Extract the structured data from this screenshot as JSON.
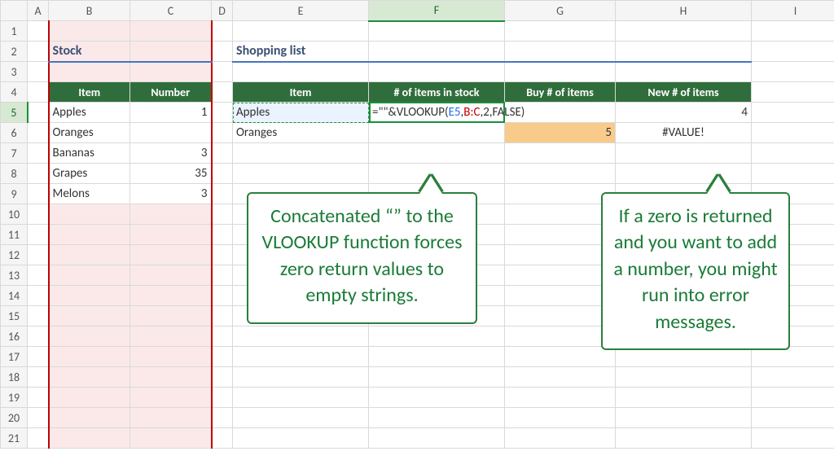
{
  "columns": [
    "A",
    "B",
    "C",
    "D",
    "E",
    "F",
    "G",
    "H",
    "I"
  ],
  "row_count": 21,
  "selected_col": "F",
  "selected_row": 5,
  "stock": {
    "title": "Stock",
    "headers": {
      "item": "Item",
      "number": "Number"
    },
    "rows": [
      {
        "item": "Apples",
        "number": "1"
      },
      {
        "item": "Oranges",
        "number": ""
      },
      {
        "item": "Bananas",
        "number": "3"
      },
      {
        "item": "Grapes",
        "number": "35"
      },
      {
        "item": "Melons",
        "number": "3"
      }
    ]
  },
  "shopping": {
    "title": "Shopping list",
    "headers": {
      "item": "Item",
      "in_stock": "# of items in stock",
      "buy": "Buy # of items",
      "new": "New # of items"
    },
    "rows": [
      {
        "item": "Apples",
        "in_stock": "",
        "buy": "",
        "new": "4"
      },
      {
        "item": "Oranges",
        "in_stock": "",
        "buy": "5",
        "new": "#VALUE!"
      }
    ]
  },
  "formula": {
    "prefix": "=\"\"&VLOOKUP(",
    "arg1": "E5",
    "sep1": ",",
    "arg2": "B:C",
    "rest": ",2,FALSE)"
  },
  "callouts": {
    "left": "Concatenated “” to the VLOOKUP function forces zero return values to empty strings.",
    "right": "If a zero is returned and you want to add a number, you might run into error messages."
  },
  "chart_data": {
    "type": "table",
    "tables": [
      {
        "name": "Stock",
        "columns": [
          "Item",
          "Number"
        ],
        "rows": [
          [
            "Apples",
            1
          ],
          [
            "Oranges",
            null
          ],
          [
            "Bananas",
            3
          ],
          [
            "Grapes",
            35
          ],
          [
            "Melons",
            3
          ]
        ]
      },
      {
        "name": "Shopping list",
        "columns": [
          "Item",
          "# of items in stock",
          "Buy # of items",
          "New # of items"
        ],
        "rows": [
          [
            "Apples",
            "=\"\"&VLOOKUP(E5,B:C,2,FALSE)",
            "",
            4
          ],
          [
            "Oranges",
            "",
            5,
            "#VALUE!"
          ]
        ]
      }
    ]
  }
}
